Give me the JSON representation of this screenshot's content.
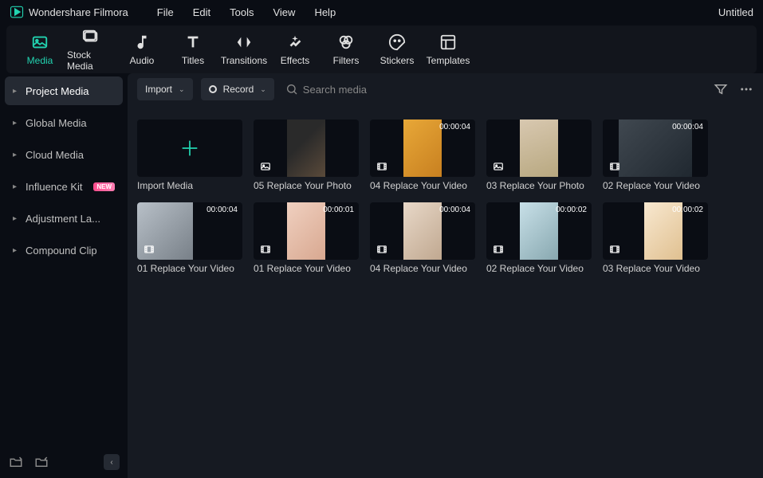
{
  "app": {
    "title": "Wondershare Filmora",
    "doc_title": "Untitled"
  },
  "menu": {
    "file": "File",
    "edit": "Edit",
    "tools": "Tools",
    "view": "View",
    "help": "Help"
  },
  "toolbar": {
    "media": "Media",
    "stock_media": "Stock Media",
    "audio": "Audio",
    "titles": "Titles",
    "transitions": "Transitions",
    "effects": "Effects",
    "filters": "Filters",
    "stickers": "Stickers",
    "templates": "Templates"
  },
  "sidebar": {
    "project_media": "Project Media",
    "global_media": "Global Media",
    "cloud_media": "Cloud Media",
    "influence_kit": "Influence Kit",
    "influence_badge": "NEW",
    "adjustment_layer": "Adjustment La...",
    "compound_clip": "Compound Clip"
  },
  "content_header": {
    "import": "Import",
    "record": "Record",
    "search_placeholder": "Search media"
  },
  "media": {
    "import_label": "Import Media",
    "items": [
      {
        "caption": "05 Replace Your Photo",
        "time": "",
        "type": "photo",
        "ph": "ph1"
      },
      {
        "caption": "04 Replace Your Video",
        "time": "00:00:04",
        "type": "video",
        "ph": "ph2"
      },
      {
        "caption": "03 Replace Your Photo",
        "time": "",
        "type": "photo",
        "ph": "ph3"
      },
      {
        "caption": "02 Replace Your Video",
        "time": "00:00:04",
        "type": "video",
        "ph": "ph4"
      },
      {
        "caption": "01 Replace Your Video",
        "time": "00:00:04",
        "type": "video",
        "ph": "ph5"
      },
      {
        "caption": "01 Replace Your Video",
        "time": "00:00:01",
        "type": "video",
        "ph": "ph6"
      },
      {
        "caption": "04 Replace Your Video",
        "time": "00:00:04",
        "type": "video",
        "ph": "ph7"
      },
      {
        "caption": "02 Replace Your Video",
        "time": "00:00:02",
        "type": "video",
        "ph": "ph8"
      },
      {
        "caption": "03 Replace Your Video",
        "time": "00:00:02",
        "type": "video",
        "ph": "ph9"
      }
    ]
  }
}
